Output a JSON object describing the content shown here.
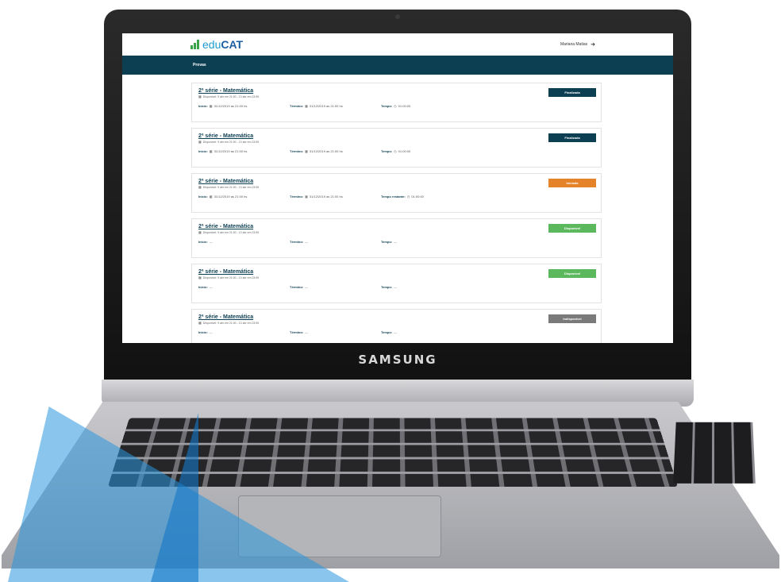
{
  "device": {
    "brand": "SAMSUNG"
  },
  "app": {
    "logo_plain": "edu",
    "logo_bold": "CAT",
    "user_name": "Mariana Matias",
    "nav_item": "Provas"
  },
  "labels": {
    "inicio": "Início:",
    "termino": "Término:",
    "tempo": "Tempo:",
    "tempo_restante": "Tempo restante:"
  },
  "cards": [
    {
      "title": "2ª série - Matemática",
      "subtitle": "Disponível: 9 abr em 21:00 - 13 abr em 23:59",
      "inicio": "31/12/2019 as 21:00 hs",
      "termino": "31/12/2019 as 21:00 hs",
      "tempo_label": "Tempo:",
      "tempo": "01:00:00",
      "status": "Finalizada"
    },
    {
      "title": "2ª série - Matemática",
      "subtitle": "Disponível: 9 abr em 21:00 - 13 abr em 23:59",
      "inicio": "31/12/2019 as 21:00 hs",
      "termino": "31/12/2019 as 21:00 hs",
      "tempo_label": "Tempo:",
      "tempo": "01:00:00",
      "status": "Finalizada"
    },
    {
      "title": "2ª série - Matemática",
      "subtitle": "Disponível: 9 abr em 21:00 - 13 abr em 23:59",
      "inicio": "31/12/2019 as 21:00 hs",
      "termino": "31/12/2019 as 21:00 hs",
      "tempo_label": "Tempo restante:",
      "tempo": "01:00:00",
      "status": "Iniciada"
    },
    {
      "title": "2ª série - Matemática",
      "subtitle": "Disponível: 9 abr em 21:00 - 13 abr em 23:59",
      "inicio": "---",
      "termino": "---",
      "tempo_label": "Tempo:",
      "tempo": "---",
      "status": "Disponível"
    },
    {
      "title": "2ª série - Matemática",
      "subtitle": "Disponível: 9 abr em 21:00 - 13 abr em 23:59",
      "inicio": "---",
      "termino": "---",
      "tempo_label": "Tempo:",
      "tempo": "---",
      "status": "Disponível"
    },
    {
      "title": "2ª série - Matemática",
      "subtitle": "Disponível: 9 abr em 21:00 - 13 abr em 23:59",
      "inicio": "---",
      "termino": "---",
      "tempo_label": "Tempo:",
      "tempo": "---",
      "status": "Indisponível"
    }
  ],
  "colors": {
    "navbar": "#0d3f52",
    "finalizada": "#0d3f52",
    "iniciada": "#e5832a",
    "disponivel": "#5cb85c",
    "indisponivel": "#7a7a7a",
    "logo_bars": "#3aa34a",
    "decor_triangle": "#2896dc"
  },
  "icons": [
    "logo-bars-icon",
    "logout-icon",
    "calendar-icon",
    "clock-icon"
  ]
}
